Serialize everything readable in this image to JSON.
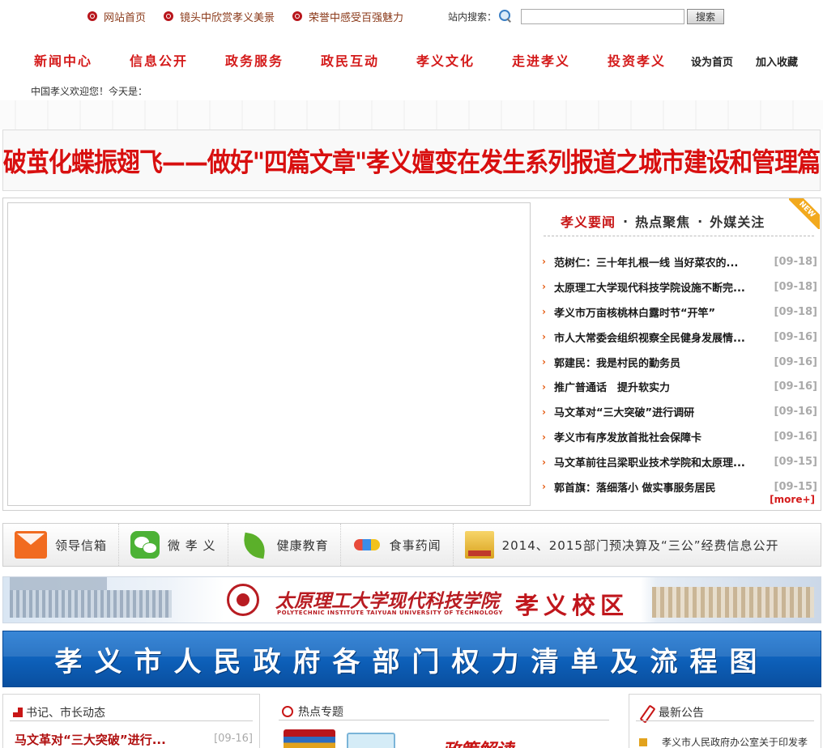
{
  "toplinks": [
    "网站首页",
    "镜头中欣赏孝义美景",
    "荣誉中感受百强魅力"
  ],
  "search": {
    "label": "站内搜索：",
    "value": "",
    "button": "搜索"
  },
  "nav": {
    "items": [
      "新闻中心",
      "信息公开",
      "政务服务",
      "政民互动",
      "孝义文化",
      "走进孝义",
      "投资孝义"
    ],
    "homepage": "设为首页",
    "favorite": "加入收藏"
  },
  "welcome": "中国孝义欢迎您！今天是：",
  "headline": "破茧化蝶振翅飞——做好\"四篇文章\"孝义嬗变在发生系列报道之城市建设和管理篇",
  "news": {
    "tabs": [
      "孝义要闻",
      "热点聚焦",
      "外媒关注"
    ],
    "tab_sep": "·",
    "badge": "NEW",
    "items": [
      {
        "title": "范树仁：三十年扎根一线 当好菜农的...",
        "date": "[09-18]"
      },
      {
        "title": "太原理工大学现代科技学院设施不断完...",
        "date": "[09-18]"
      },
      {
        "title": "孝义市万亩核桃林白露时节“开竿”",
        "date": "[09-18]"
      },
      {
        "title": "市人大常委会组织视察全民健身发展情...",
        "date": "[09-16]"
      },
      {
        "title": "郭建民：我是村民的勤务员",
        "date": "[09-16]"
      },
      {
        "title": "推广普通话　提升软实力",
        "date": "[09-16]"
      },
      {
        "title": "马文革对“三大突破”进行调研",
        "date": "[09-16]"
      },
      {
        "title": "孝义市有序发放首批社会保障卡",
        "date": "[09-16]"
      },
      {
        "title": "马文革前往吕梁职业技术学院和太原理...",
        "date": "[09-15]"
      },
      {
        "title": "郭首旗：落细落小 做实事服务居民",
        "date": "[09-15]"
      }
    ],
    "more": "[more+]"
  },
  "iconbar": [
    {
      "label": "领导信箱",
      "icon": "mail-icon"
    },
    {
      "label": "微 孝 义",
      "icon": "wechat-icon"
    },
    {
      "label": "健康教育",
      "icon": "leaf-icon"
    },
    {
      "label": "食事药闻",
      "icon": "food-icon"
    },
    {
      "label": "2014、2015部门预决算及“三公”经费信息公开",
      "icon": "gold-icon"
    }
  ],
  "banner_college": {
    "name": "太原理工大学现代科技学院",
    "english": "POLYTECHNIC INSTITUTE TAIYUAN UNIVERSITY OF TECHNOLOGY",
    "campus": "孝义校区"
  },
  "banner_power": "孝义市人民政府各部门权力清单及流程图",
  "panels": {
    "leaders": {
      "title": "书记、市长动态",
      "item": "马文革对“三大突破”进行...",
      "date": "[09-16]"
    },
    "topics": {
      "title": "热点专题",
      "art": "政策解读"
    },
    "notice": {
      "title": "最新公告",
      "item": "孝义市人民政府办公室关于印发孝"
    }
  },
  "colors": {
    "accent": "#d41a1a",
    "link": "#8b3a1a",
    "banner_blue": "#0d5fb8"
  }
}
